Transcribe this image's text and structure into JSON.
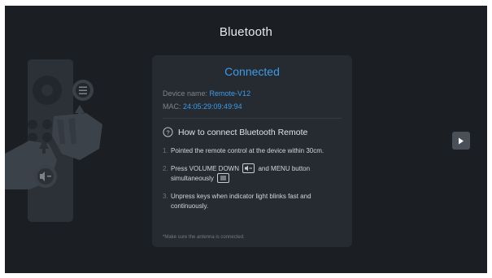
{
  "title": "Bluetooth",
  "status": "Connected",
  "device": {
    "name_label": "Device name:",
    "name_value": "Remote-V12",
    "mac_label": "MAC:",
    "mac_value": "24:05:29:09:49:94"
  },
  "howto": {
    "title": "How to connect Bluetooth Remote",
    "steps": [
      {
        "num": "1.",
        "text": "Pointed the remote control at the device within 30cm."
      },
      {
        "num": "2.",
        "text_a": "Press VOLUME DOWN",
        "text_b": "and MENU button",
        "text_c": "simultaneously"
      },
      {
        "num": "3.",
        "text": "Unpress keys when indicator light blinks fast and continuously."
      }
    ]
  },
  "note": "*Make sure the antenna is connected.",
  "icons": {
    "help": "question-circle-icon",
    "volume_down": "volume-down-icon",
    "menu": "menu-icon",
    "next": "play-icon"
  },
  "colors": {
    "background": "#1b1f24",
    "card": "#262b31",
    "accent": "#3d9be9"
  }
}
